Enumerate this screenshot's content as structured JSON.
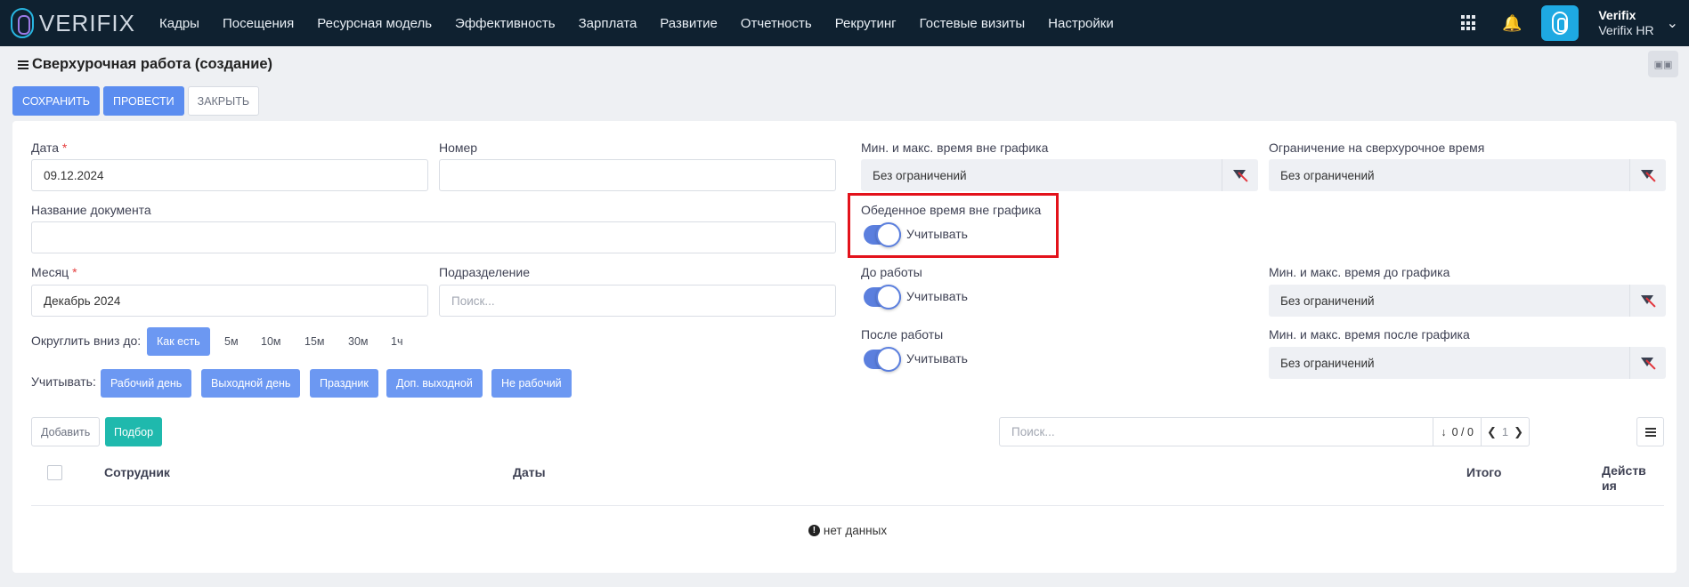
{
  "app": {
    "logo_text": "VERIFIX",
    "nav": [
      "Кадры",
      "Посещения",
      "Ресурсная модель",
      "Эффективность",
      "Зарплата",
      "Развитие",
      "Отчетность",
      "Рекрутинг",
      "Гостевые визиты",
      "Настройки"
    ],
    "user": {
      "name": "Verifix",
      "company": "Verifix HR"
    }
  },
  "page": {
    "title": "Сверхурочная работа (создание)",
    "buttons": {
      "save": "СОХРАНИТЬ",
      "post": "ПРОВЕСТИ",
      "close": "ЗАКРЫТЬ"
    }
  },
  "form": {
    "date": {
      "label": "Дата",
      "required": "*",
      "value": "09.12.2024"
    },
    "number": {
      "label": "Номер",
      "value": ""
    },
    "doc_name": {
      "label": "Название документа",
      "value": ""
    },
    "month": {
      "label": "Месяц",
      "required": "*",
      "value": "Декабрь 2024"
    },
    "department": {
      "label": "Подразделение",
      "placeholder": "Поиск..."
    },
    "round": {
      "label": "Округлить вниз до:",
      "options": [
        "Как есть",
        "5м",
        "10м",
        "15м",
        "30м",
        "1ч"
      ],
      "selected": "Как есть"
    },
    "count": {
      "label": "Учитывать:",
      "options": [
        "Рабочий день",
        "Выходной день",
        "Праздник",
        "Доп. выходной",
        "Не рабочий"
      ]
    },
    "min_max_outside": {
      "label": "Мин. и макс. время вне графика",
      "value": "Без ограничений"
    },
    "overtime_limit": {
      "label": "Ограничение на сверхурочное время",
      "value": "Без ограничений"
    },
    "lunch_outside": {
      "label": "Обеденное время вне графика",
      "toggle_label": "Учитывать",
      "enabled": true
    },
    "before_work": {
      "label": "До работы",
      "toggle_label": "Учитывать",
      "enabled": true
    },
    "min_max_before": {
      "label": "Мин. и макс. время до графика",
      "value": "Без ограничений"
    },
    "after_work": {
      "label": "После работы",
      "toggle_label": "Учитывать",
      "enabled": true
    },
    "min_max_after": {
      "label": "Мин. и макс. время после графика",
      "value": "Без ограничений"
    }
  },
  "table": {
    "add_button": "Добавить",
    "pick_button": "Подбор",
    "search_placeholder": "Поиск...",
    "count": "0 / 0",
    "page": "1",
    "columns": {
      "employee": "Сотрудник",
      "dates": "Даты",
      "total": "Итого",
      "actions_line1": "Действ",
      "actions_line2": "ия"
    },
    "empty_text": "нет данных"
  },
  "colors": {
    "primary": "#5b8df0",
    "teal": "#1fb9ad",
    "topbar": "#0f2130",
    "highlight": "#e3121b"
  }
}
